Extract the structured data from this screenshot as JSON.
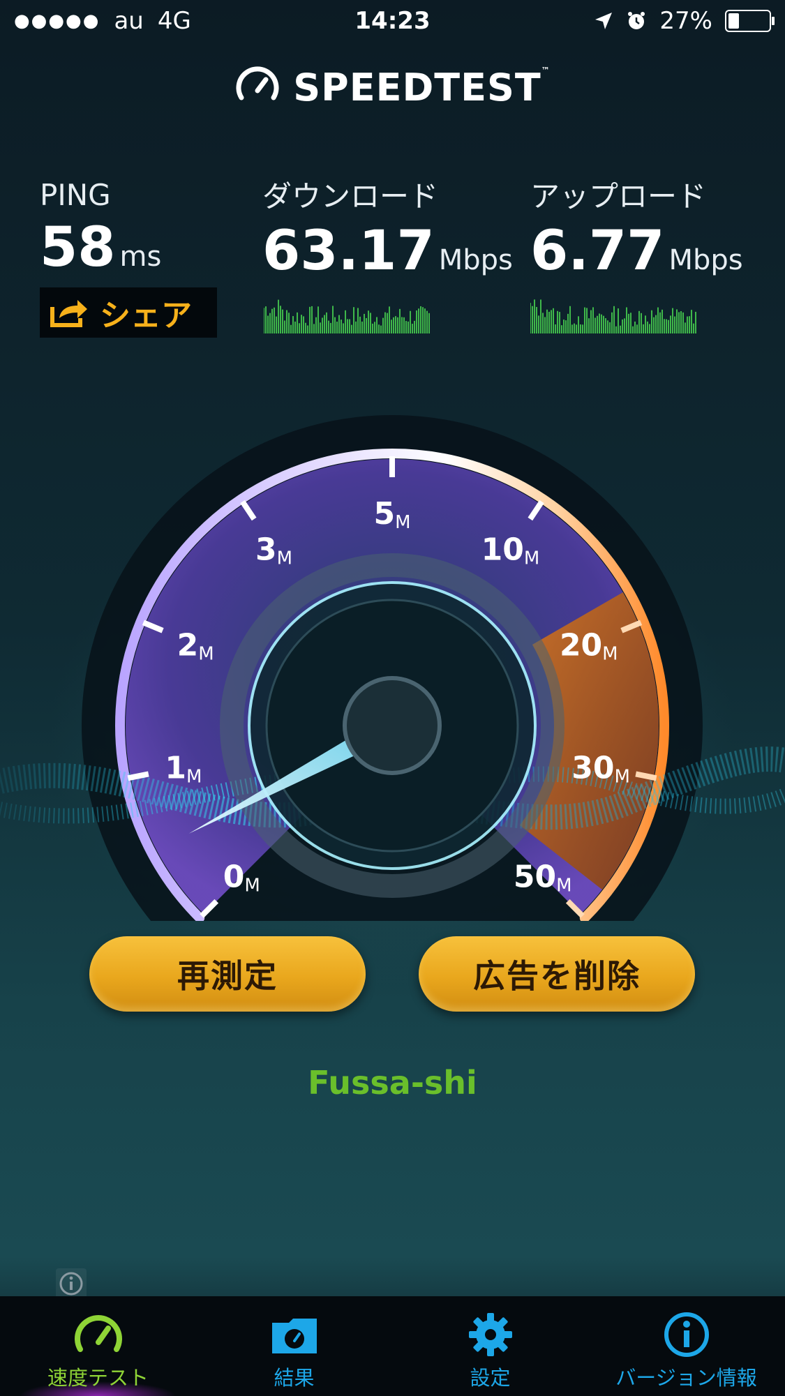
{
  "status_bar": {
    "signal": "●●●●●",
    "carrier": "au",
    "network": "4G",
    "time": "14:23",
    "battery": "27%",
    "battery_level": 0.27,
    "icons": [
      "location-arrow-icon",
      "alarm-icon",
      "battery-icon"
    ]
  },
  "header": {
    "logo_text": "SPEEDTEST",
    "trademark": "™"
  },
  "metrics": {
    "ping": {
      "label": "PING",
      "value": "58",
      "unit": "ms"
    },
    "download": {
      "label": "ダウンロード",
      "value": "63.17",
      "unit": "Mbps"
    },
    "upload": {
      "label": "アップロード",
      "value": "6.77",
      "unit": "Mbps"
    }
  },
  "share_button": {
    "label": "シェア"
  },
  "gauge": {
    "ticks": [
      {
        "num": "0",
        "unit": "M"
      },
      {
        "num": "1",
        "unit": "M"
      },
      {
        "num": "2",
        "unit": "M"
      },
      {
        "num": "3",
        "unit": "M"
      },
      {
        "num": "5",
        "unit": "M"
      },
      {
        "num": "10",
        "unit": "M"
      },
      {
        "num": "20",
        "unit": "M"
      },
      {
        "num": "30",
        "unit": "M"
      },
      {
        "num": "50",
        "unit": "M"
      }
    ],
    "colors": {
      "arc_low": "#6a3fb8",
      "arc_high": "#e07a2a",
      "needle": "#7fe3ff"
    }
  },
  "buttons": {
    "retest": "再測定",
    "remove_ads": "広告を削除"
  },
  "location": "Fussa-shi",
  "tabs": [
    {
      "label": "速度テスト",
      "icon": "speedometer-icon",
      "active": true
    },
    {
      "label": "結果",
      "icon": "results-folder-icon",
      "active": false
    },
    {
      "label": "設定",
      "icon": "gear-icon",
      "active": false
    },
    {
      "label": "バージョン情報",
      "icon": "info-icon",
      "active": false
    }
  ]
}
